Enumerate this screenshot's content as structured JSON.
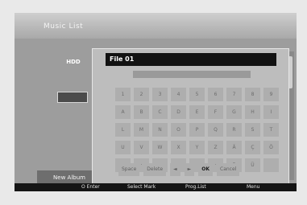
{
  "header": {
    "title": "Music List"
  },
  "left_panel": {
    "hdd_label": "HDD",
    "box_label": "",
    "new_album_label": "New Album"
  },
  "keyboard": {
    "input_value": "File 01",
    "rows": [
      [
        "1",
        "2",
        "3",
        "4",
        "5",
        "6",
        "7",
        "8",
        "9"
      ],
      [
        "A",
        "B",
        "C",
        "D",
        "E",
        "F",
        "G",
        "H",
        "I"
      ],
      [
        "L",
        "M",
        "N",
        "O",
        "P",
        "Q",
        "R",
        "S",
        "T"
      ],
      [
        "U",
        "V",
        "W",
        "X",
        "Y",
        "Z",
        "Ä",
        "Ç",
        "Ö"
      ],
      [
        "-",
        "·",
        "+",
        "",
        "",
        "·",
        "ß",
        "Ü",
        ""
      ]
    ],
    "actions": {
      "space": "Space",
      "delete": "Delete",
      "left": "◄",
      "right": "►",
      "ok": "OK",
      "cancel": "Cancel"
    }
  },
  "footer": {
    "hint1": "O Enter",
    "hint2": "Select Mark",
    "hint3": "Prog.List",
    "hint4": "Menu"
  }
}
